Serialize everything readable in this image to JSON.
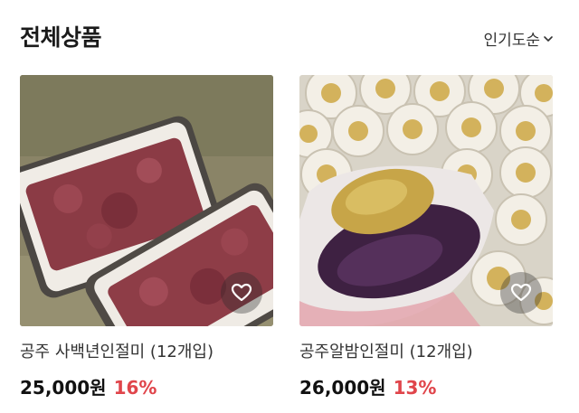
{
  "header": {
    "title": "전체상품",
    "sort_label": "인기도순"
  },
  "products": [
    {
      "name": "공주 사백년인절미 (12개입)",
      "price": "25,000원",
      "discount": "16%"
    },
    {
      "name": "공주알밤인절미 (12개입)",
      "price": "26,000원",
      "discount": "13%"
    }
  ],
  "colors": {
    "discount": "#e0454b",
    "price": "#111111"
  },
  "icons": {
    "sort": "chevron-down-icon",
    "wishlist": "heart-icon"
  }
}
